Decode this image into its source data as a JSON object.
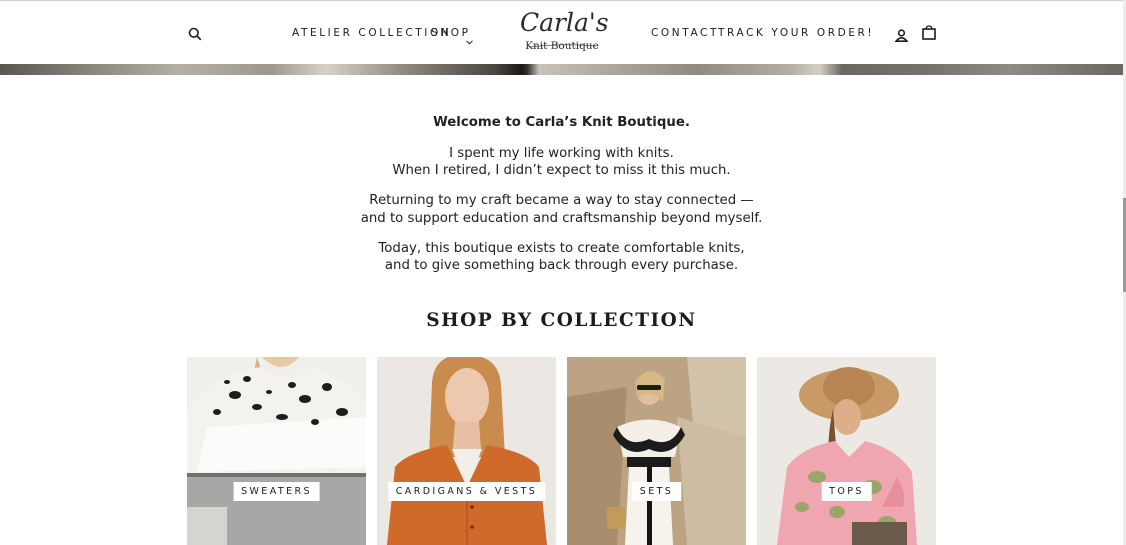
{
  "header": {
    "nav_left": [
      "Atelier Collection",
      "Shop"
    ],
    "nav_right": [
      "Contact",
      "Track your order!"
    ],
    "logo": {
      "name": "Carla's",
      "tagline": "Knit Boutique"
    },
    "icons": [
      "search-icon",
      "chevron-down-icon",
      "user-account-icon",
      "shopping-bag-icon"
    ]
  },
  "intro": {
    "welcome": "Welcome to Carla’s Knit Boutique.",
    "p1_line1": "I spent my life working with knits.",
    "p1_line2": "When I retired, I didn’t expect to miss it this much.",
    "p2_line1": "Returning to my craft became a way to stay connected —",
    "p2_line2": "and to support education and craftsmanship beyond myself.",
    "p3_line1": "Today, this boutique exists to create comfortable knits,",
    "p3_line2": "and to give something back through every purchase."
  },
  "collections": {
    "title": "SHOP BY COLLECTION",
    "items": [
      {
        "label": "Sweaters"
      },
      {
        "label": "Cardigans & Vests"
      },
      {
        "label": "Sets"
      },
      {
        "label": "Tops"
      }
    ]
  },
  "colors": {
    "text": "#1c1c1c",
    "background": "#ffffff"
  }
}
